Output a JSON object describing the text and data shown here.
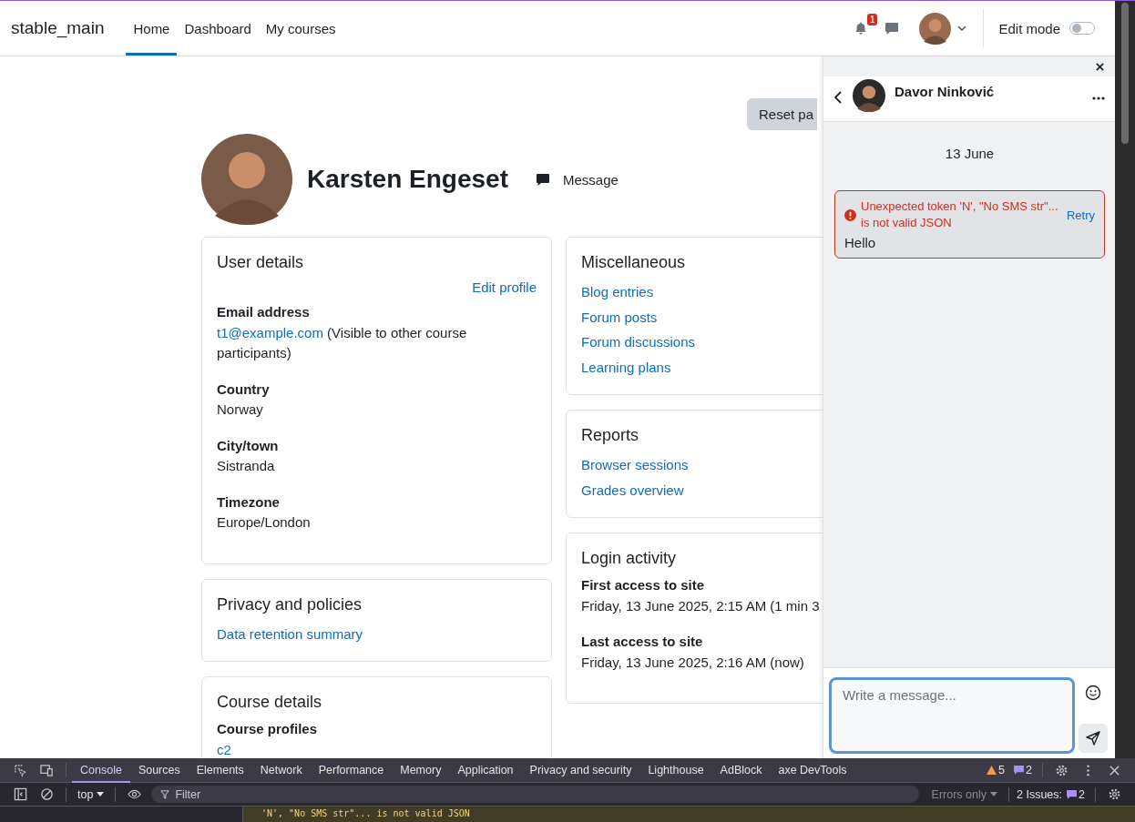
{
  "navbar": {
    "site_name": "stable_main",
    "links": [
      {
        "label": "Home",
        "selected": true
      },
      {
        "label": "Dashboard",
        "selected": false
      },
      {
        "label": "My courses",
        "selected": false
      }
    ],
    "notification_count": "1",
    "edit_mode": {
      "label": "Edit mode",
      "on": false
    }
  },
  "page": {
    "reset_button": "Reset pa",
    "profile": {
      "name": "Karsten Engeset",
      "message_label": "Message"
    },
    "left_cards": [
      {
        "title": "User details",
        "edit_link": "Edit profile",
        "items": [
          {
            "kind": "field",
            "label": "Email address",
            "link": "t1@example.com",
            "value": "(Visible to other course participants)"
          },
          {
            "kind": "field",
            "label": "Country",
            "value": "Norway"
          },
          {
            "kind": "field",
            "label": "City/town",
            "value": "Sistranda"
          },
          {
            "kind": "field",
            "label": "Timezone",
            "value": "Europe/London"
          }
        ]
      },
      {
        "title": "Privacy and policies",
        "items": [
          {
            "kind": "link",
            "text": "Data retention summary"
          }
        ]
      },
      {
        "title": "Course details",
        "items": [
          {
            "kind": "field",
            "label": "Course profiles",
            "link": "c2"
          }
        ]
      }
    ],
    "right_cards": [
      {
        "title": "Miscellaneous",
        "items": [
          {
            "kind": "link",
            "text": "Blog entries"
          },
          {
            "kind": "link",
            "text": "Forum posts"
          },
          {
            "kind": "link",
            "text": "Forum discussions"
          },
          {
            "kind": "link",
            "text": "Learning plans"
          }
        ]
      },
      {
        "title": "Reports",
        "items": [
          {
            "kind": "link",
            "text": "Browser sessions"
          },
          {
            "kind": "link",
            "text": "Grades overview"
          }
        ]
      },
      {
        "title": "Login activity",
        "items": [
          {
            "kind": "field",
            "label": "First access to site",
            "value": "Friday, 13 June 2025, 2:15 AM  (1 min 3"
          },
          {
            "kind": "field",
            "label": "Last access to site",
            "value": "Friday, 13 June 2025, 2:16 AM  (now)"
          }
        ]
      }
    ]
  },
  "drawer": {
    "contact": "Davor Ninković",
    "date": "13 June",
    "messages": [
      {
        "error": "Unexpected token 'N', \"No SMS str\"... is not valid JSON",
        "retry": "Retry",
        "text": "Hello"
      }
    ],
    "composer": {
      "placeholder": "Write a message..."
    }
  },
  "devtools": {
    "tabs": [
      {
        "label": "Console",
        "selected": true
      },
      {
        "label": "Sources",
        "selected": false
      },
      {
        "label": "Elements",
        "selected": false
      },
      {
        "label": "Network",
        "selected": false
      },
      {
        "label": "Performance",
        "selected": false
      },
      {
        "label": "Memory",
        "selected": false
      },
      {
        "label": "Application",
        "selected": false
      },
      {
        "label": "Privacy and security",
        "selected": false
      },
      {
        "label": "Lighthouse",
        "selected": false
      },
      {
        "label": "AdBlock",
        "selected": false
      },
      {
        "label": "axe DevTools",
        "selected": false
      }
    ],
    "warning_count": "5",
    "message_count": "2",
    "context": "top",
    "filter_placeholder": "Filter",
    "levels": "Errors only",
    "issues_label": "2 Issues:",
    "issues_count": "2",
    "console_line": "'N', \"No SMS str\"... is not valid JSON"
  }
}
